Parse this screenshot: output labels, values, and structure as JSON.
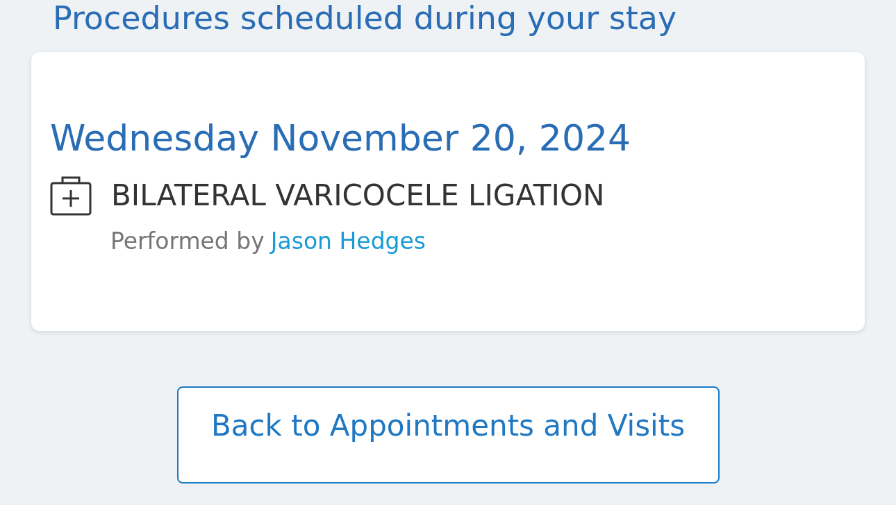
{
  "heading": "Procedures scheduled during your stay",
  "procedures": [
    {
      "date": "Wednesday November 20, 2024",
      "name": "BILATERAL VARICOCELE LIGATION",
      "performed_by_label": "Performed by",
      "performer": "Jason Hedges"
    }
  ],
  "back_button": "Back to Appointments and Visits"
}
